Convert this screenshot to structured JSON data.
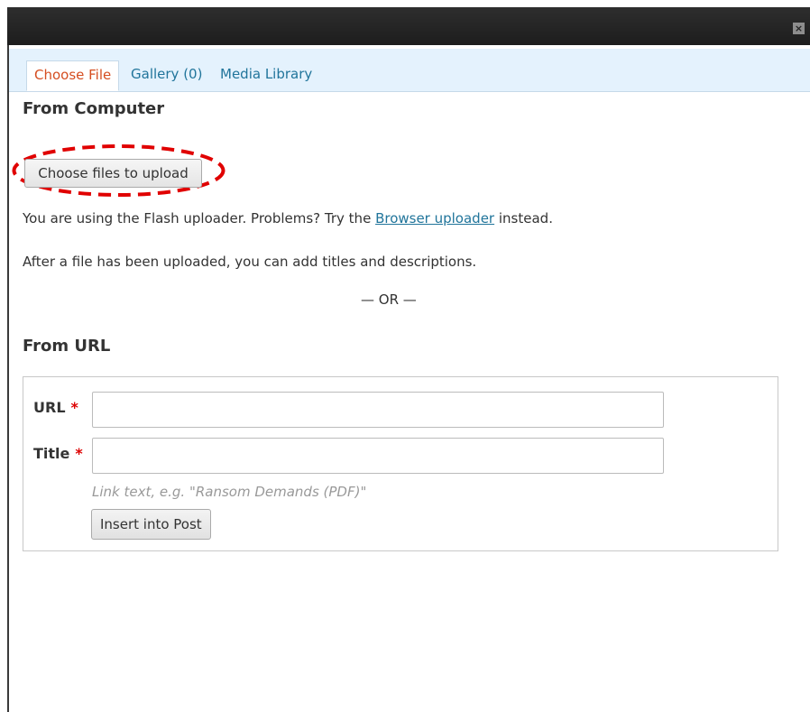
{
  "dialog": {
    "close_glyph": "×"
  },
  "tabs": [
    {
      "label": "Choose File",
      "active": true
    },
    {
      "label": "Gallery (0)",
      "active": false
    },
    {
      "label": "Media Library",
      "active": false
    }
  ],
  "from_computer": {
    "heading": "From Computer",
    "upload_button": "Choose files to upload",
    "flash_prefix": "You are using the Flash uploader. Problems? Try the ",
    "browser_link": "Browser uploader",
    "flash_suffix": " instead.",
    "after_note": "After a file has been uploaded, you can add titles and descriptions."
  },
  "separator": "— OR —",
  "from_url": {
    "heading": "From URL",
    "url_label": "URL",
    "title_label": "Title",
    "required_mark": "*",
    "url_value": "",
    "title_value": "",
    "help_text": "Link text, e.g. \"Ransom Demands (PDF)\"",
    "insert_button": "Insert into Post"
  },
  "colors": {
    "active_tab": "#d54e21",
    "link": "#21759b",
    "tabbar_bg": "#e4f2fd",
    "required": "#dd0000",
    "highlight_ring": "#e00000"
  },
  "icons": {
    "close": "close-icon"
  }
}
